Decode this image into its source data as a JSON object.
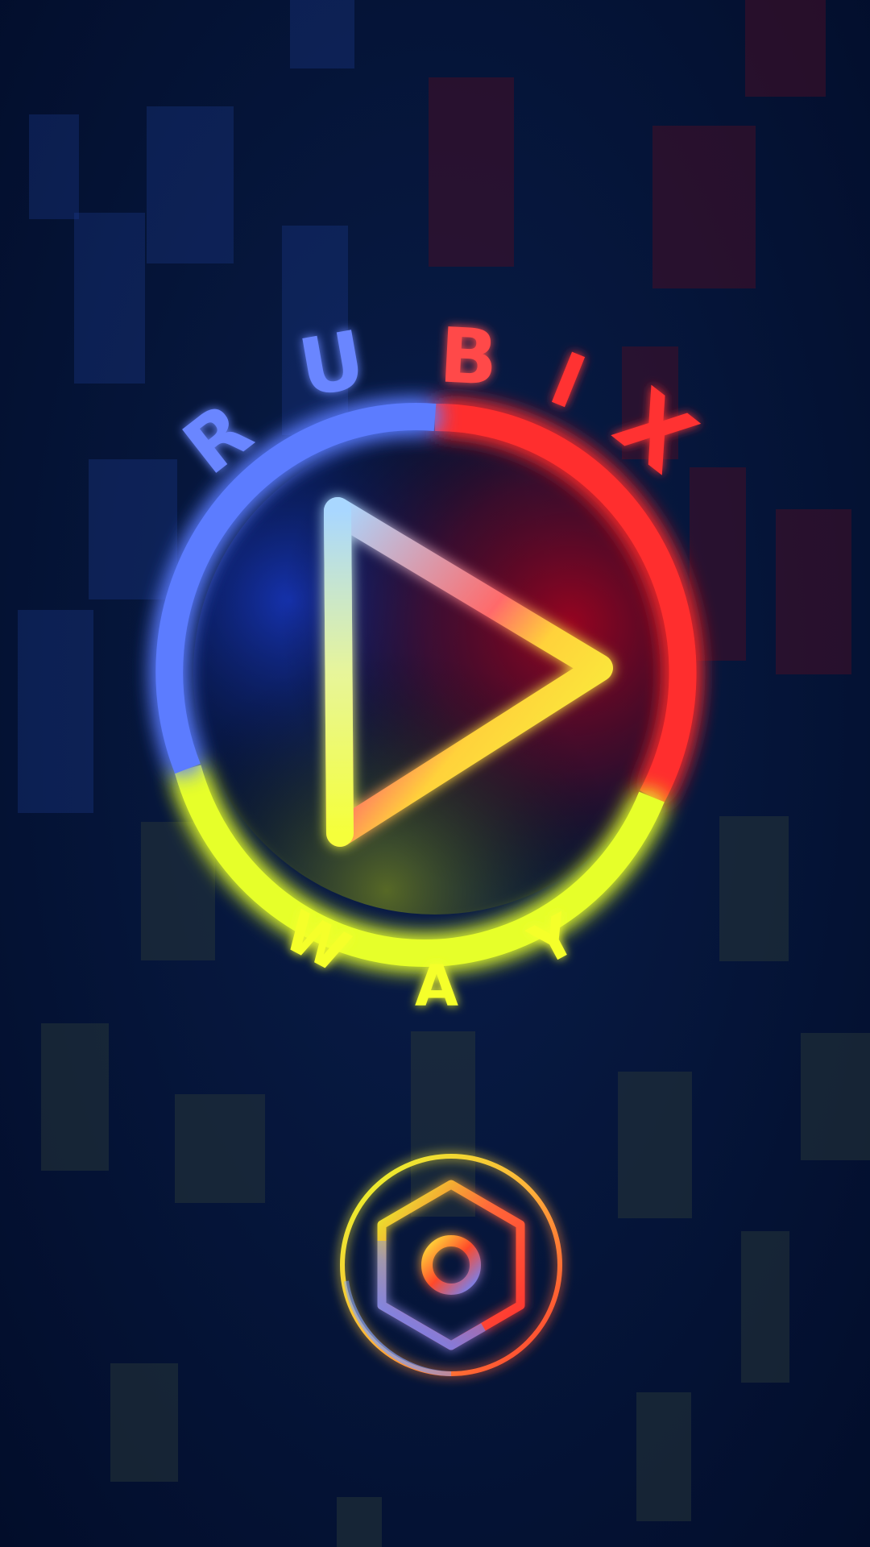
{
  "logo": {
    "title_letters": [
      "R",
      "U",
      "B",
      "I",
      "X"
    ],
    "subtitle_letters": [
      "W",
      "A",
      "Y"
    ]
  },
  "play_button": {
    "icon": "play-triangle-icon"
  },
  "settings_button": {
    "icon": "hexagon-settings-icon"
  },
  "colors": {
    "blue": "#5b7cff",
    "red": "#ff2e2e",
    "yellow": "#e6ff2a",
    "background": "#06173d"
  }
}
